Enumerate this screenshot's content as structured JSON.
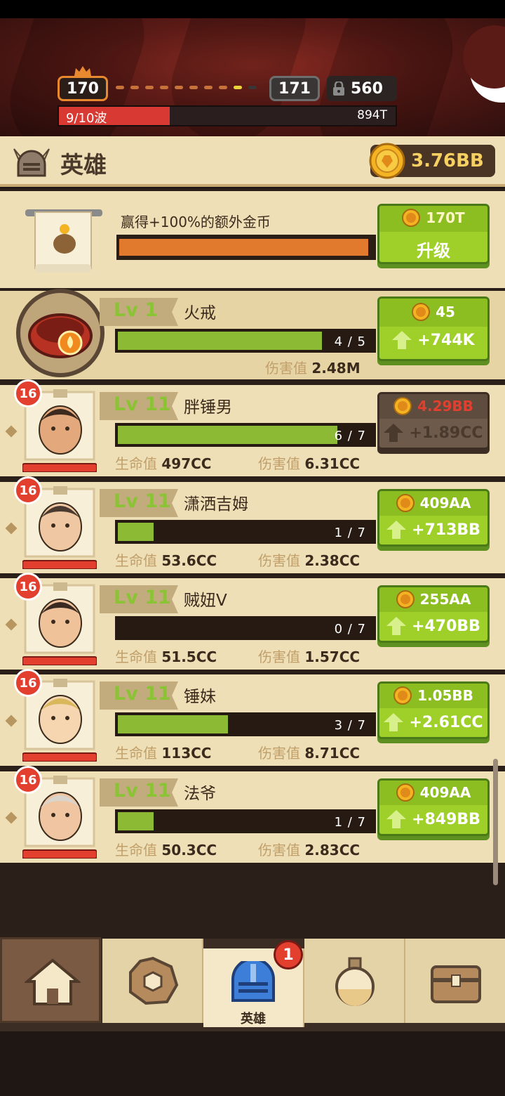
{
  "hud": {
    "current_level": "170",
    "next_level": "171",
    "locked_count": "560",
    "wave_label": "9/10波",
    "wave_progress": 0.33,
    "enemy_hp": "894T"
  },
  "header": {
    "title": "英雄",
    "gold_amount": "3.76BB"
  },
  "bonus": {
    "title": "赢得+100%的额外金币",
    "progress": 0.97,
    "cost": "170T",
    "button_label": "升级"
  },
  "equipment": {
    "level_prefix": "Lv",
    "level": "1",
    "name": "火戒",
    "progress_text": "4 / 5",
    "progress": 0.8,
    "damage_label": "伤害值",
    "damage_value": "2.48M",
    "cost": "45",
    "gain": "+744K"
  },
  "heroes": [
    {
      "badge": "16",
      "level_prefix": "Lv",
      "level": "11",
      "name": "胖锤男",
      "progress_text": "6 / 7",
      "progress": 0.86,
      "hp_label": "生命值",
      "hp": "497CC",
      "dmg_label": "伤害值",
      "dmg": "6.31CC",
      "cost": "4.29BB",
      "gain": "+1.89CC",
      "affordable": false
    },
    {
      "badge": "16",
      "level_prefix": "Lv",
      "level": "11",
      "name": "潇洒吉姆",
      "progress_text": "1 / 7",
      "progress": 0.14,
      "hp_label": "生命值",
      "hp": "53.6CC",
      "dmg_label": "伤害值",
      "dmg": "2.38CC",
      "cost": "409AA",
      "gain": "+713BB",
      "affordable": true
    },
    {
      "badge": "16",
      "level_prefix": "Lv",
      "level": "11",
      "name": "贼妞V",
      "progress_text": "0 / 7",
      "progress": 0.0,
      "hp_label": "生命值",
      "hp": "51.5CC",
      "dmg_label": "伤害值",
      "dmg": "1.57CC",
      "cost": "255AA",
      "gain": "+470BB",
      "affordable": true
    },
    {
      "badge": "16",
      "level_prefix": "Lv",
      "level": "11",
      "name": "锤妹",
      "progress_text": "3 / 7",
      "progress": 0.43,
      "hp_label": "生命值",
      "hp": "113CC",
      "dmg_label": "伤害值",
      "dmg": "8.71CC",
      "cost": "1.05BB",
      "gain": "+2.61CC",
      "affordable": true
    },
    {
      "badge": "16",
      "level_prefix": "Lv",
      "level": "11",
      "name": "法爷",
      "progress_text": "1 / 7",
      "progress": 0.14,
      "hp_label": "生命值",
      "hp": "50.3CC",
      "dmg_label": "伤害值",
      "dmg": "2.83CC",
      "cost": "409AA",
      "gain": "+849BB",
      "affordable": true
    }
  ],
  "nav": {
    "items": [
      {
        "icon": "home-icon"
      },
      {
        "icon": "gear-icon"
      },
      {
        "icon": "helmet-icon",
        "label": "英雄",
        "badge": "1"
      },
      {
        "icon": "potion-icon"
      },
      {
        "icon": "chest-icon"
      }
    ]
  },
  "colors": {
    "accent_green": "#9fd029",
    "panel": "#efdfb6",
    "gold": "#f6d062",
    "unaffordable_red": "#e23f2f"
  }
}
